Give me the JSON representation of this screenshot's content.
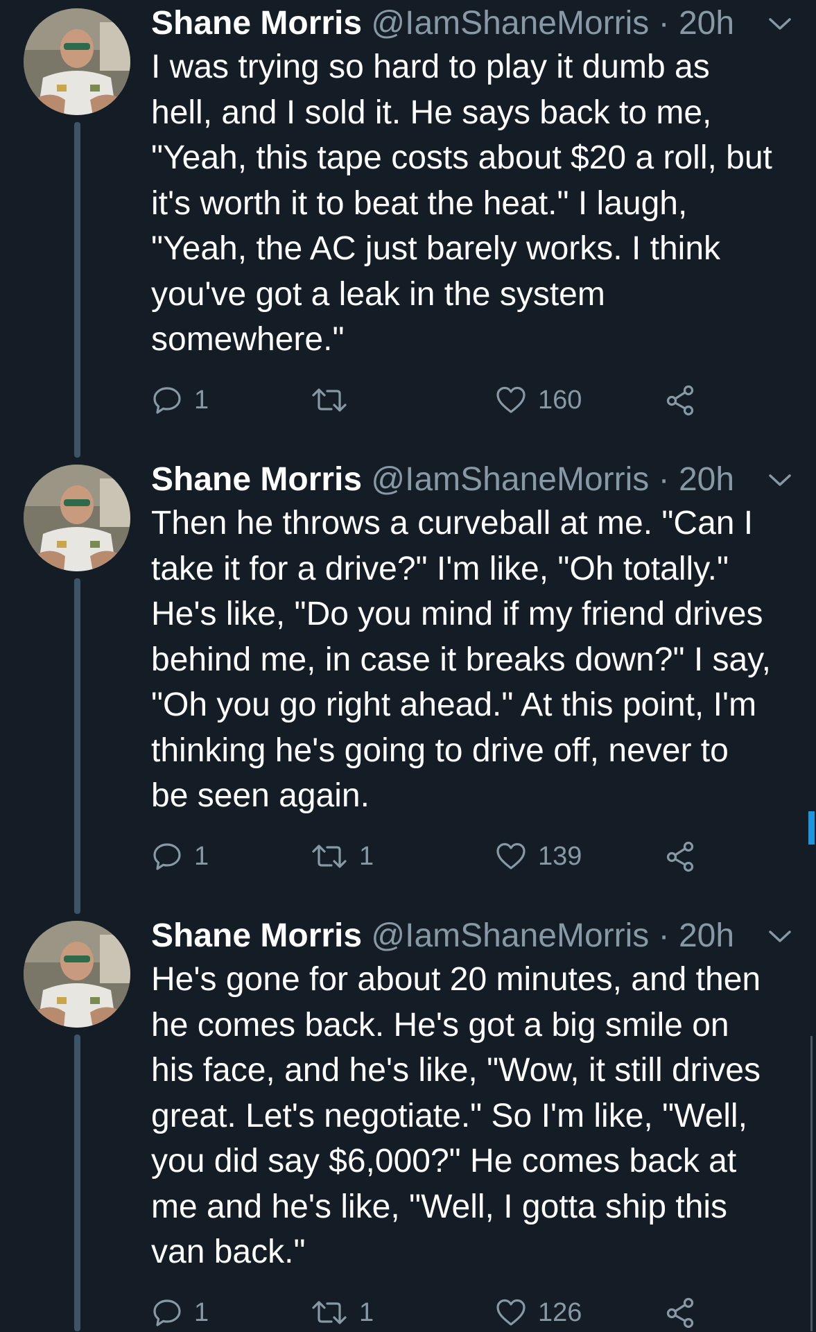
{
  "tweets": [
    {
      "name": "Shane Morris",
      "handle": "@IamShaneMorris",
      "separator": "·",
      "time": "20h",
      "lines": [
        "I was trying so hard to play it dumb as",
        "hell, and I sold it. He says back to me,",
        "\"Yeah, this tape costs about $20 a roll, but",
        "it's worth it to beat the heat.\" I laugh,",
        "\"Yeah, the AC just barely works. I think",
        "you've got a leak in the system",
        "somewhere.\""
      ],
      "replies": "1",
      "retweets": "",
      "likes": "160"
    },
    {
      "name": "Shane Morris",
      "handle": "@IamShaneMorris",
      "separator": "·",
      "time": "20h",
      "lines": [
        "Then he throws a curveball at me. \"Can I",
        "take it for a drive?\" I'm like, \"Oh totally.\"",
        "He's like, \"Do you mind if my friend drives",
        "behind me, in case it breaks down?\" I say,",
        "\"Oh you go right ahead.\" At this point, I'm",
        "thinking he's going to drive off, never to",
        "be seen again."
      ],
      "replies": "1",
      "retweets": "1",
      "likes": "139"
    },
    {
      "name": "Shane Morris",
      "handle": "@IamShaneMorris",
      "separator": "·",
      "time": "20h",
      "lines": [
        "He's gone for about 20 minutes, and then",
        "he comes back. He's got a big smile on",
        "his face, and he's like, \"Wow, it still drives",
        "great. Let's negotiate.\" So I'm like, \"Well,",
        "you did say $6,000?\" He comes back at",
        "me and he's like, \"Well, I gotta ship this",
        "van back.\""
      ],
      "replies": "1",
      "retweets": "1",
      "likes": "126"
    }
  ],
  "icons": {
    "reply": "reply-icon",
    "retweet": "retweet-icon",
    "like": "heart-icon",
    "share": "share-icon",
    "menu": "chevron-down-icon",
    "avatar": "profile-photo"
  },
  "colors": {
    "background": "#141d26",
    "text": "#ffffff",
    "secondary": "#8899a6",
    "thread_line": "#3d5466",
    "accent": "#1b95e0"
  }
}
